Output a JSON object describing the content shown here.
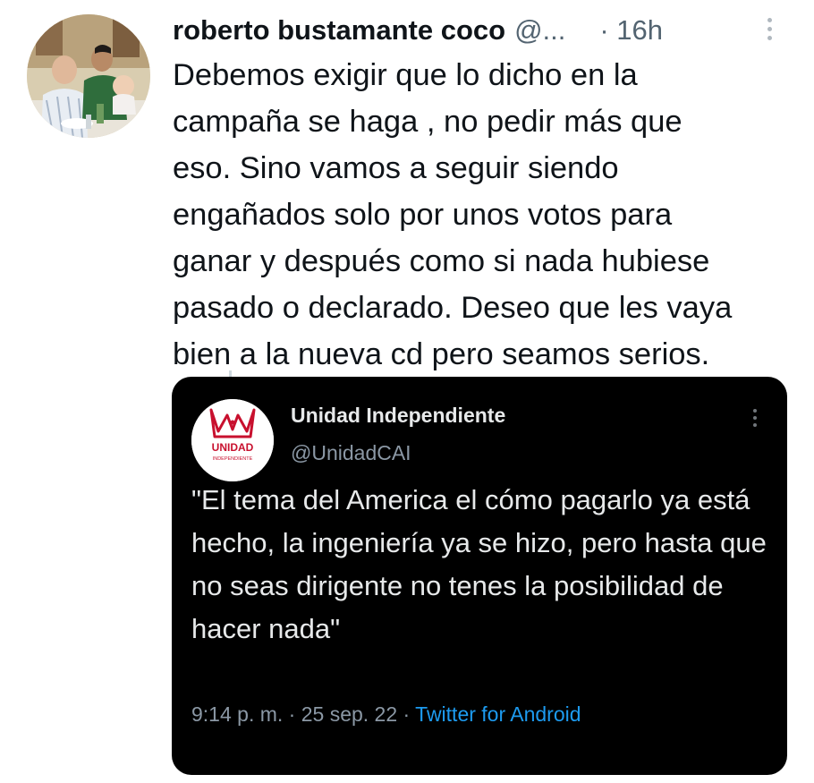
{
  "tweet": {
    "author_name": "roberto bustamante coco",
    "author_handle": "@...",
    "time": "· 16h",
    "text": "Debemos exigir que lo dicho en la\ncampaña se haga , no pedir más que\neso. Sino vamos a seguir siendo\nengañados solo por unos votos para\nganar y después como si nada hubiese\npasado o declarado. Deseo que les vaya\nbien a la nueva cd pero seamos serios."
  },
  "quote": {
    "name": "Unidad Independiente",
    "handle": "@UnidadCAI",
    "logo_text": "UNIDAD",
    "logo_subtext": "INDEPENDIENTE",
    "text": "\"El tema del America el cómo pagarlo ya está hecho, la ingeniería ya se hizo, pero hasta que no seas dirigente no tenes la posibilidad de hacer nada\"",
    "timestamp": "9:14 p. m. · 25 sep. 22 · ",
    "source": "Twitter for Android"
  },
  "icons": {
    "more_top": "more-vertical-icon",
    "more_quote": "more-vertical-icon",
    "logo": "crown-logo"
  },
  "colors": {
    "text_primary": "#0f1419",
    "text_secondary": "#536471",
    "quote_bg": "#000000",
    "quote_text": "#e7e9ea",
    "link": "#1d9bf0",
    "logo_red": "#c8102e"
  }
}
